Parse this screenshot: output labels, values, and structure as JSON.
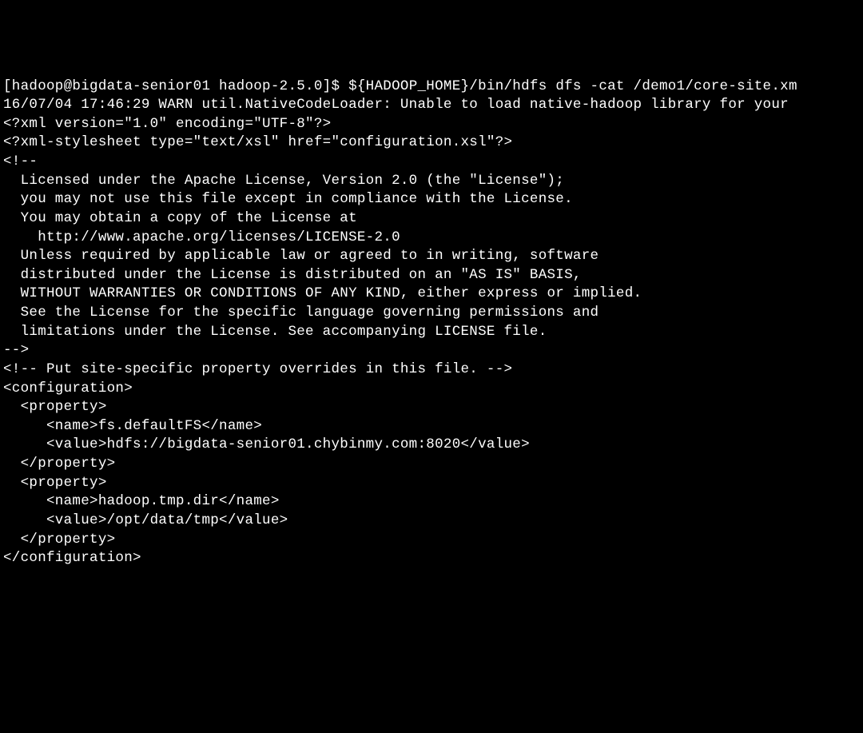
{
  "terminal": {
    "prompt": "[hadoop@bigdata-senior01 hadoop-2.5.0]$ ",
    "command": "${HADOOP_HOME}/bin/hdfs dfs -cat /demo1/core-site.xm",
    "lines": [
      "16/07/04 17:46:29 WARN util.NativeCodeLoader: Unable to load native-hadoop library for your ",
      "<?xml version=\"1.0\" encoding=\"UTF-8\"?>",
      "<?xml-stylesheet type=\"text/xsl\" href=\"configuration.xsl\"?>",
      "<!--",
      "  Licensed under the Apache License, Version 2.0 (the \"License\");",
      "  you may not use this file except in compliance with the License.",
      "  You may obtain a copy of the License at",
      "",
      "    http://www.apache.org/licenses/LICENSE-2.0",
      "",
      "  Unless required by applicable law or agreed to in writing, software",
      "  distributed under the License is distributed on an \"AS IS\" BASIS,",
      "  WITHOUT WARRANTIES OR CONDITIONS OF ANY KIND, either express or implied.",
      "  See the License for the specific language governing permissions and",
      "  limitations under the License. See accompanying LICENSE file.",
      "-->",
      "",
      "<!-- Put site-specific property overrides in this file. -->",
      "",
      "<configuration>",
      "  <property>",
      "     <name>fs.defaultFS</name>",
      "     <value>hdfs://bigdata-senior01.chybinmy.com:8020</value>",
      "  </property>",
      "  <property>",
      "     <name>hadoop.tmp.dir</name>",
      "     <value>/opt/data/tmp</value>",
      "  </property>",
      "</configuration>"
    ]
  }
}
